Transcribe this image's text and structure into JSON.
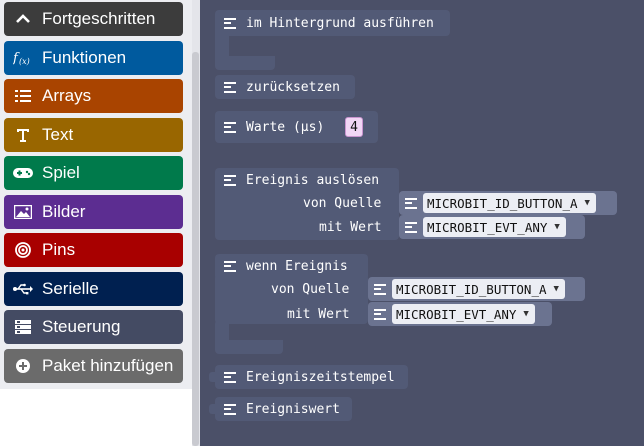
{
  "toolbox": {
    "categories": [
      {
        "label": "Fortgeschritten",
        "icon": "chevron-up-icon",
        "color": "#3c3c3c"
      },
      {
        "label": "Funktionen",
        "icon": "function-icon",
        "color": "#005a9e"
      },
      {
        "label": "Arrays",
        "icon": "list-icon",
        "color": "#a94400"
      },
      {
        "label": "Text",
        "icon": "text-icon",
        "color": "#996600"
      },
      {
        "label": "Spiel",
        "icon": "gamepad-icon",
        "color": "#007a4b"
      },
      {
        "label": "Bilder",
        "icon": "image-icon",
        "color": "#5c2d91"
      },
      {
        "label": "Pins",
        "icon": "pins-icon",
        "color": "#a80000"
      },
      {
        "label": "Serielle",
        "icon": "usb-icon",
        "color": "#002050"
      },
      {
        "label": "Steuerung",
        "icon": "control-icon",
        "color": "#444b63"
      },
      {
        "label": "Paket hinzufügen",
        "icon": "add-icon",
        "color": "#6b6b6b"
      }
    ]
  },
  "flyout": {
    "run_in_background": "im Hintergrund ausführen",
    "reset": "zurücksetzen",
    "wait_label": "Warte (µs)",
    "wait_value": "4",
    "raise_event": {
      "title": "Ereignis auslösen",
      "source_label": "von Quelle",
      "source_value": "MICROBIT_ID_BUTTON_A",
      "value_label": "mit Wert",
      "value_value": "MICROBIT_EVT_ANY"
    },
    "on_event": {
      "title": "wenn Ereignis",
      "source_label": "von Quelle",
      "source_value": "MICROBIT_ID_BUTTON_A",
      "value_label": "mit Wert",
      "value_value": "MICROBIT_EVT_ANY"
    },
    "event_timestamp": "Ereigniszeitstempel",
    "event_value": "Ereigniswert"
  },
  "colors": {
    "flyout_bg": "#4b5068",
    "block": "#525a76",
    "number_slot": "#f1d6f5"
  }
}
